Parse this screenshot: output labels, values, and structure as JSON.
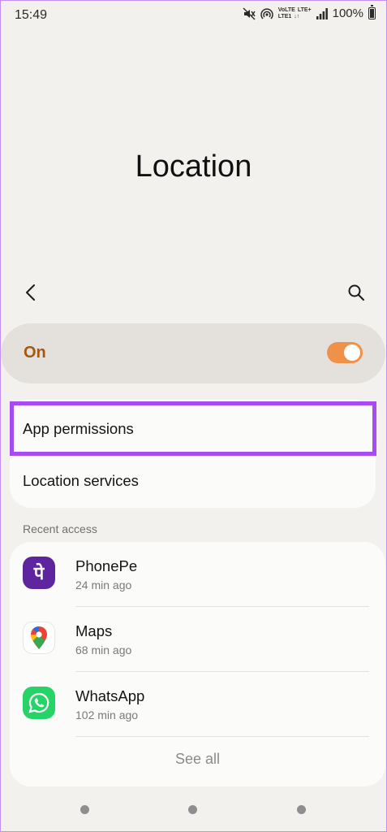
{
  "status_bar": {
    "time": "15:49",
    "network_top_left": "VoLTE",
    "network_top_right": "LTE+",
    "network_bottom_left": "LTE1",
    "network_bottom_right": "↓↑",
    "battery": "100%"
  },
  "page": {
    "title": "Location"
  },
  "master_toggle": {
    "label": "On",
    "checked": true,
    "accent_color": "#f0914a"
  },
  "settings": {
    "items": [
      {
        "label": "App permissions"
      },
      {
        "label": "Location services"
      }
    ]
  },
  "recent_access": {
    "header": "Recent access",
    "apps": [
      {
        "name": "PhonePe",
        "time": "24 min ago",
        "icon": "phonepe-icon"
      },
      {
        "name": "Maps",
        "time": "68 min ago",
        "icon": "maps-icon"
      },
      {
        "name": "WhatsApp",
        "time": "102 min ago",
        "icon": "whatsapp-icon"
      }
    ],
    "see_all": "See all"
  },
  "colors": {
    "highlight": "#a64cf0",
    "background": "#f3f1ee"
  }
}
